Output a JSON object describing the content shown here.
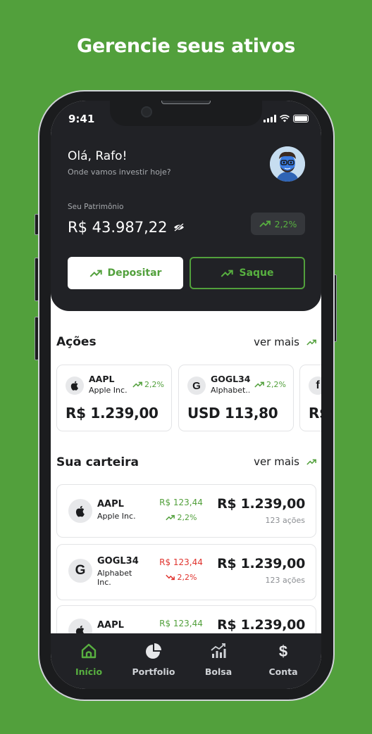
{
  "headline": "Gerencie seus ativos",
  "status_bar": {
    "time": "9:41"
  },
  "header": {
    "greeting": "Olá, Rafo!",
    "subtitle": "Onde vamos investir hoje?",
    "patrimonio_label": "Seu Patrimônio",
    "patrimonio_value": "R$ 43.987,22",
    "patrimonio_change": "2,2%",
    "deposit_label": "Depositar",
    "withdraw_label": "Saque"
  },
  "acoes": {
    "title": "Ações",
    "more_label": "ver mais",
    "cards": [
      {
        "ticker": "AAPL",
        "name": "Apple Inc.",
        "change": "2,2%",
        "price": "R$ 1.239,00",
        "logo": "apple-icon"
      },
      {
        "ticker": "GOGL34",
        "name": "Alphabet...",
        "change": "2,2%",
        "price": "USD 113,80",
        "logo": "google-icon"
      },
      {
        "ticker": "",
        "name": "",
        "change": "",
        "price": "R$",
        "logo": "facebook-icon"
      }
    ]
  },
  "carteira": {
    "title": "Sua carteira",
    "more_label": "ver mais",
    "items": [
      {
        "ticker": "AAPL",
        "name": "Apple Inc.",
        "delta": "R$ 123,44",
        "pct": "2,2%",
        "value": "R$ 1.239,00",
        "qty": "123 ações",
        "trend": "up",
        "logo": "apple-icon"
      },
      {
        "ticker": "GOGL34",
        "name": "Alphabet Inc.",
        "delta": "R$ 123,44",
        "pct": "2,2%",
        "value": "R$ 1.239,00",
        "qty": "123 ações",
        "trend": "down",
        "logo": "google-icon"
      },
      {
        "ticker": "AAPL",
        "name": "",
        "delta": "R$ 123,44",
        "pct": "",
        "value": "R$ 1.239,00",
        "qty": "",
        "trend": "up",
        "logo": "apple-icon"
      }
    ]
  },
  "tabs": [
    {
      "label": "Início",
      "icon": "home-icon",
      "active": true
    },
    {
      "label": "Portfolio",
      "icon": "pie-chart-icon",
      "active": false
    },
    {
      "label": "Bolsa",
      "icon": "stock-chart-icon",
      "active": false
    },
    {
      "label": "Conta",
      "icon": "dollar-icon",
      "active": false
    }
  ],
  "colors": {
    "brand_green": "#52a03c",
    "dark": "#212226",
    "negative": "#e0332e"
  }
}
